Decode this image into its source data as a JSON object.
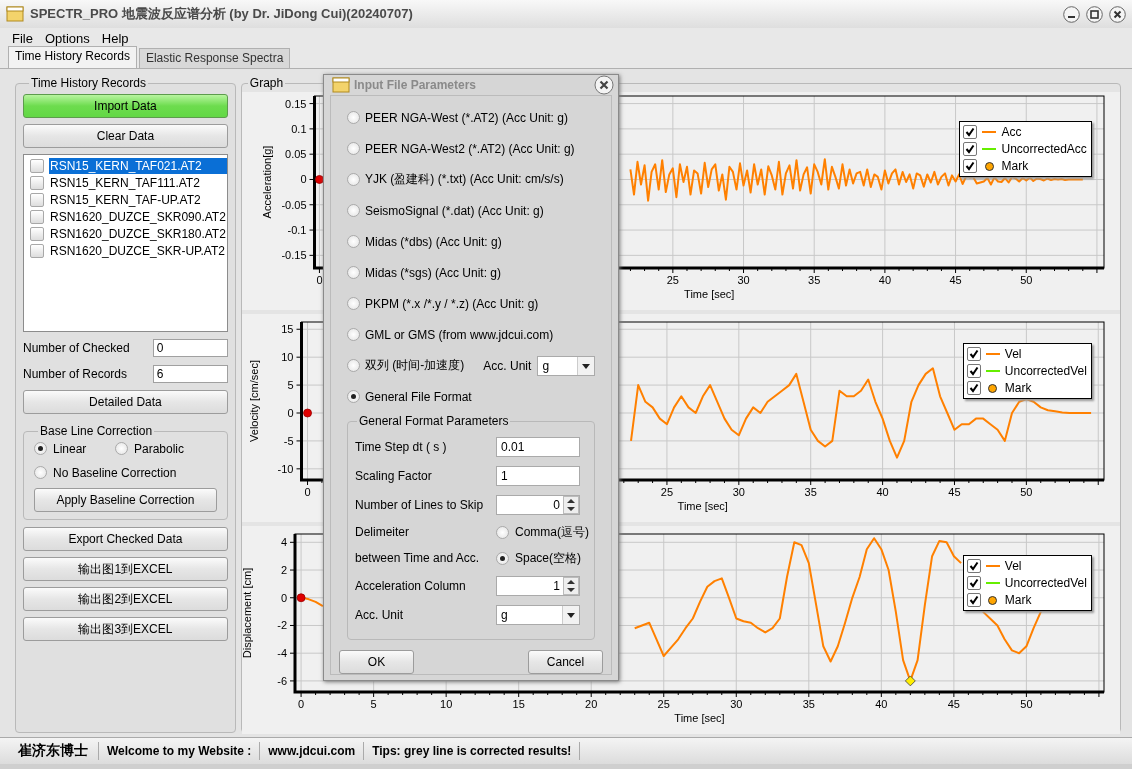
{
  "window": {
    "title": "SPECTR_PRO 地震波反应谱分析 (by Dr. JiDong Cui)(20240707)"
  },
  "menu": [
    "File",
    "Options",
    "Help"
  ],
  "tabs": [
    {
      "label": "Time History Records",
      "selected": true
    },
    {
      "label": "Elastic Response Spectra",
      "selected": false
    }
  ],
  "records_panel": {
    "title": "Time History Records",
    "import_button": "Import Data",
    "clear_button": "Clear Data",
    "files": [
      {
        "name": "RSN15_KERN_TAF021.AT2",
        "checked": false,
        "selected": true
      },
      {
        "name": "RSN15_KERN_TAF111.AT2",
        "checked": false,
        "selected": false
      },
      {
        "name": "RSN15_KERN_TAF-UP.AT2",
        "checked": false,
        "selected": false
      },
      {
        "name": "RSN1620_DUZCE_SKR090.AT2",
        "checked": false,
        "selected": false
      },
      {
        "name": "RSN1620_DUZCE_SKR180.AT2",
        "checked": false,
        "selected": false
      },
      {
        "name": "RSN1620_DUZCE_SKR-UP.AT2",
        "checked": false,
        "selected": false
      }
    ],
    "checked_count": {
      "label": "Number of Checked",
      "value": "0"
    },
    "record_count": {
      "label": "Number of Records",
      "value": "6"
    },
    "detail_button": "Detailed Data",
    "baseline": {
      "title": "Base Line Correction",
      "options": [
        {
          "label": "Linear",
          "selected": true
        },
        {
          "label": "Parabolic",
          "selected": false
        },
        {
          "label": "No Baseline Correction",
          "selected": false
        }
      ],
      "apply_button": "Apply Baseline Correction"
    },
    "export_buttons": [
      "Export Checked Data",
      "输出图1到EXCEL",
      "输出图2到EXCEL",
      "输出图3到EXCEL"
    ]
  },
  "graph": {
    "title": "Graph",
    "charts": [
      {
        "chart_data": {
          "type": "line",
          "xlabel": "Time [sec]",
          "ylabel": "Acceleration[g]",
          "xlim": [
            -0.35,
            55.5
          ],
          "ylim": [
            -0.175,
            0.165
          ],
          "grid": true,
          "yticks": [
            0.15,
            0.1,
            0.05,
            0,
            -0.05,
            -0.1,
            -0.15
          ],
          "xticks": [
            0,
            25,
            30,
            35,
            40,
            45,
            50
          ],
          "x": [
            22,
            22.25,
            22.5,
            22.75,
            23,
            23.25,
            23.5,
            23.75,
            24,
            24.25,
            24.5,
            24.75,
            25,
            25.25,
            25.5,
            25.75,
            26,
            26.25,
            26.5,
            26.75,
            27,
            27.25,
            27.5,
            27.75,
            28,
            28.25,
            28.5,
            28.75,
            29,
            29.25,
            29.5,
            29.75,
            30,
            30.25,
            30.5,
            30.75,
            31,
            31.25,
            31.5,
            31.75,
            32,
            32.25,
            32.5,
            32.75,
            33,
            33.25,
            33.5,
            33.75,
            34,
            34.25,
            34.5,
            34.75,
            35,
            35.25,
            35.5,
            35.75,
            36,
            36.25,
            36.5,
            36.75,
            37,
            37.25,
            37.5,
            37.75,
            38,
            38.25,
            38.5,
            38.75,
            39,
            39.25,
            39.5,
            39.75,
            40,
            40.25,
            40.5,
            40.75,
            41,
            41.25,
            41.5,
            41.75,
            42,
            42.25,
            42.5,
            42.75,
            43,
            43.25,
            43.5,
            43.75,
            44,
            44.25,
            44.5,
            44.75,
            45,
            45.25,
            45.5,
            45.75,
            46,
            46.25,
            46.5,
            46.75,
            47,
            47.25,
            47.5,
            47.75,
            48,
            48.25,
            48.5,
            48.75,
            49,
            49.25,
            49.5,
            49.75,
            50,
            50.25,
            50.5,
            50.75,
            51,
            51.25,
            51.5,
            51.75,
            52,
            52.25,
            52.5,
            52.75,
            53,
            53.25,
            53.5,
            53.75,
            54
          ],
          "series": [
            {
              "color": "#ff8000",
              "values": [
                0.02,
                -0.03,
                0.035,
                -0.01,
                0.028,
                -0.042,
                0.015,
                0.03,
                -0.02,
                0.038,
                -0.025,
                0.01,
                0.022,
                -0.035,
                0.03,
                -0.005,
                0.025,
                -0.03,
                0.018,
                0.012,
                -0.028,
                0.033,
                -0.015,
                0.02,
                0.03,
                -0.022,
                0.01,
                -0.04,
                0.025,
                0.015,
                -0.02,
                0.032,
                -0.012,
                0.018,
                -0.026,
                0.03,
                -0.01,
                0.02,
                -0.03,
                0.026,
                0.008,
                -0.02,
                0.035,
                -0.03,
                0.012,
                0.028,
                -0.018,
                0.038,
                -0.022,
                0.01,
                0.024,
                -0.028,
                0.03,
                0.015,
                -0.01,
                0.04,
                -0.02,
                0.025,
                0.005,
                -0.018,
                0.03,
                -0.012,
                0.02,
                -0.008,
                0.012,
                0.015,
                -0.012,
                0.02,
                -0.015,
                0.01,
                0.005,
                -0.02,
                0.018,
                -0.008,
                0.012,
                0.02,
                -0.01,
                0.015,
                -0.005,
                0.01,
                -0.018,
                0.012,
                0.008,
                -0.014,
                0.01,
                -0.006,
                0.015,
                -0.01,
                0.005,
                0.012,
                -0.012,
                0.008,
                -0.004,
                0.01,
                -0.009,
                0.006,
                0.004,
                0.005,
                -0.008,
                -0.006,
                -0.004,
                0.003,
                -0.01,
                0.004,
                -0.004,
                -0.005,
                0.003,
                -0.006,
                0.005,
                0.002,
                -0.004,
                0.003,
                -0.002,
                0.004,
                -0.003,
                0.002,
                0.001,
                -0.002,
                0.002,
                -0.001,
                0.001,
                0,
                0.001,
                -0.001,
                0,
                0,
                0,
                0,
                0
              ]
            }
          ]
        },
        "legend": [
          {
            "label": "Acc",
            "checked": true,
            "kind": "line",
            "color": "#ff8000"
          },
          {
            "label": "UncorrectedAcc",
            "checked": true,
            "kind": "line",
            "color": "#66ee00"
          },
          {
            "label": "Mark",
            "checked": true,
            "kind": "marker",
            "color": "#ffa500"
          }
        ]
      },
      {
        "chart_data": {
          "type": "line",
          "xlabel": "Time [sec]",
          "ylabel": "Velocity [cm/sec]",
          "xlim": [
            -0.42,
            55.4
          ],
          "ylim": [
            -12,
            16.3
          ],
          "grid": true,
          "yticks": [
            15,
            10,
            5,
            0,
            -5,
            -10
          ],
          "xticks": [
            0,
            25,
            30,
            35,
            40,
            45,
            50
          ],
          "x": [
            22.5,
            23,
            23.5,
            24,
            24.5,
            25,
            25.5,
            26,
            26.5,
            27,
            27.5,
            28,
            28.5,
            29,
            29.5,
            30,
            30.5,
            31,
            31.5,
            32,
            32.5,
            33,
            33.5,
            34,
            34.5,
            35,
            35.5,
            36,
            36.5,
            37,
            37.5,
            38,
            38.5,
            39,
            39.5,
            40,
            40.5,
            41,
            41.5,
            42,
            42.5,
            43,
            43.5,
            44,
            44.5,
            45,
            45.5,
            46,
            46.5,
            47,
            47.5,
            48,
            48.5,
            49,
            49.5,
            50,
            50.5,
            51,
            51.5,
            52,
            52.5,
            53,
            53.5,
            54,
            54.5
          ],
          "series": [
            {
              "color": "#ff8000",
              "values": [
                -5,
                5,
                2,
                1,
                -1,
                -2,
                1,
                3,
                1,
                0,
                3,
                5,
                2,
                -1,
                -3,
                -4,
                -1,
                1,
                0,
                2,
                3,
                4,
                5,
                7,
                2,
                -3,
                -5,
                -6,
                -5,
                4,
                3,
                3,
                4,
                6,
                2,
                -1,
                -5,
                -8,
                -5,
                2,
                5,
                7,
                8,
                3,
                0,
                -3,
                -2,
                -2,
                -1,
                -1,
                -2,
                -3,
                -5,
                0,
                2,
                2.5,
                2,
                1,
                0.5,
                0.3,
                0.1,
                0,
                0,
                0,
                0
              ]
            }
          ]
        },
        "legend": [
          {
            "label": "Vel",
            "checked": true,
            "kind": "line",
            "color": "#ff8000"
          },
          {
            "label": "UncorrectedVel",
            "checked": true,
            "kind": "line",
            "color": "#66ee00"
          },
          {
            "label": "Mark",
            "checked": true,
            "kind": "marker",
            "color": "#ffa500"
          }
        ]
      },
      {
        "peak_mark": true,
        "chart_data": {
          "type": "line",
          "xlabel": "Time [sec]",
          "ylabel": "Displacement [cm]",
          "xlim": [
            -0.42,
            55.35
          ],
          "ylim": [
            -6.8,
            4.6
          ],
          "grid": true,
          "yticks": [
            4,
            2,
            0,
            -2,
            -4,
            -6
          ],
          "xticks": [
            0,
            5,
            10,
            15,
            20,
            25,
            30,
            35,
            40,
            45,
            50
          ],
          "x": [
            0,
            0.5,
            1,
            1.5,
            2,
            23,
            23.5,
            24,
            24.5,
            25,
            25.5,
            26,
            26.5,
            27,
            27.5,
            28,
            28.5,
            29,
            29.5,
            30,
            30.5,
            31,
            31.5,
            32,
            32.5,
            33,
            33.5,
            34,
            34.5,
            35,
            35.5,
            36,
            36.5,
            37,
            37.5,
            38,
            38.5,
            39,
            39.5,
            40,
            40.5,
            41,
            41.5,
            42,
            42.5,
            43,
            43.5,
            44,
            44.5,
            45,
            45.5,
            46,
            46.5,
            47,
            47.5,
            48,
            48.5,
            49,
            49.5,
            50,
            50.5,
            51
          ],
          "series": [
            {
              "color": "#ff8000",
              "values": [
                0,
                -0.1,
                -0.3,
                -0.6,
                null,
                -2.2,
                -2,
                -1.8,
                -3,
                -4.2,
                -3.6,
                -3,
                -2.2,
                -1.5,
                -0.3,
                0.8,
                1.2,
                1.4,
                0,
                -1.5,
                -1.7,
                -1.8,
                -2.2,
                -2.5,
                -2.2,
                -1.5,
                1.5,
                4,
                3.8,
                2.5,
                -0.5,
                -3.5,
                -4.6,
                -3.5,
                -1.8,
                0,
                1.5,
                3.5,
                4.3,
                3.5,
                2,
                -1,
                -4.5,
                -6,
                -4.5,
                -0.5,
                3,
                4.1,
                4,
                3,
                2.5,
                null,
                null,
                -1,
                -1.5,
                -2,
                -3,
                -3.8,
                -4,
                -3.5,
                -2.2,
                -1
              ]
            }
          ]
        },
        "legend": [
          {
            "label": "Vel",
            "checked": true,
            "kind": "line",
            "color": "#ff8000"
          },
          {
            "label": "UncorrectedVel",
            "checked": true,
            "kind": "line",
            "color": "#66ee00"
          },
          {
            "label": "Mark",
            "checked": true,
            "kind": "marker",
            "color": "#ffa500"
          }
        ]
      }
    ]
  },
  "dialog": {
    "title": "Input File Parameters",
    "formats": [
      {
        "label": "PEER NGA-West (*.AT2) (Acc Unit: g)",
        "selected": false
      },
      {
        "label": "PEER NGA-West2 (*.AT2) (Acc Unit: g)",
        "selected": false
      },
      {
        "label": "YJK (盈建科) (*.txt) (Acc Unit: cm/s/s)",
        "selected": false
      },
      {
        "label": "SeismoSignal (*.dat) (Acc Unit: g)",
        "selected": false
      },
      {
        "label": "Midas (*dbs) (Acc Unit: g)",
        "selected": false
      },
      {
        "label": "Midas (*sgs) (Acc Unit: g)",
        "selected": false
      },
      {
        "label": "PKPM (*.x /*.y / *.z) (Acc Unit: g)",
        "selected": false
      },
      {
        "label": "GML or GMS (from www.jdcui.com)",
        "selected": false
      },
      {
        "label": "双列 (时间-加速度)",
        "selected": false,
        "unit_label": "Acc. Unit",
        "unit_value": "g"
      },
      {
        "label": "General File Format",
        "selected": true
      }
    ],
    "group": {
      "title": "General Format Parameters",
      "fields": [
        {
          "kind": "text",
          "label": "Time Step dt ( s )",
          "value": "0.01"
        },
        {
          "kind": "text",
          "label": "Scaling Factor",
          "value": "1"
        },
        {
          "kind": "spin",
          "label": "Number of Lines to Skip",
          "value": "0"
        },
        {
          "kind": "radio",
          "label": "Delimeiter",
          "sublabel": "between Time and Acc.",
          "options": [
            {
              "label": "Comma(逗号)",
              "selected": false
            },
            {
              "label": "Space(空格)",
              "selected": true
            }
          ]
        },
        {
          "kind": "spin",
          "label": "Acceleration Column",
          "value": "1"
        },
        {
          "kind": "combo",
          "label": "Acc. Unit",
          "value": "g"
        }
      ]
    },
    "ok_button": "OK",
    "cancel_button": "Cancel"
  },
  "status_bar": [
    "崔济东博士",
    "Welcome to my Website :",
    "www.jdcui.com",
    "Tips: grey line is corrected results!"
  ]
}
